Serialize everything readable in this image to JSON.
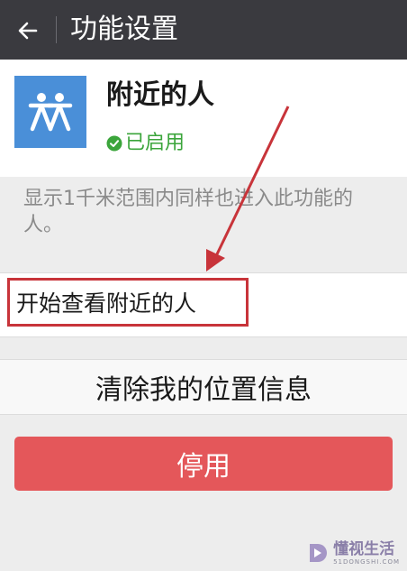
{
  "header": {
    "title": "功能设置"
  },
  "feature": {
    "name": "附近的人",
    "status": "已启用",
    "status_color": "#3ba53b",
    "icon_color": "#4a8fd8"
  },
  "description": "显示1千米范围内同样也进入此功能的人。",
  "actions": {
    "start_label": "开始查看附近的人",
    "clear_label": "清除我的位置信息",
    "disable_label": "停用",
    "disable_color": "#e4575a"
  },
  "annotation": {
    "color": "#c8343a"
  },
  "watermark": {
    "name": "懂视生活",
    "domain": "51DONGSHI.COM"
  }
}
